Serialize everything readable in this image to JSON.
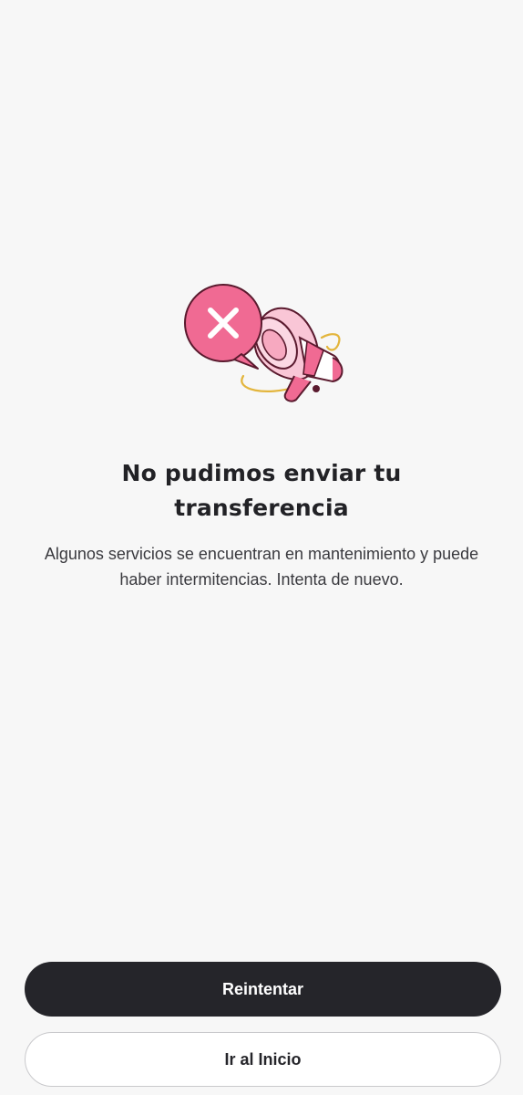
{
  "error": {
    "title": "No pudimos enviar tu transferencia",
    "message": "Algunos servicios se encuentran en mantenimiento y puede haber intermitencias. Intenta de nuevo.",
    "illustration_icon": "megaphone-error-icon"
  },
  "actions": {
    "retry_label": "Reintentar",
    "home_label": "Ir al Inicio"
  },
  "colors": {
    "background": "#f7f7f7",
    "accent_pink": "#f06a93",
    "primary_button": "#25252a",
    "text": "#222226"
  }
}
